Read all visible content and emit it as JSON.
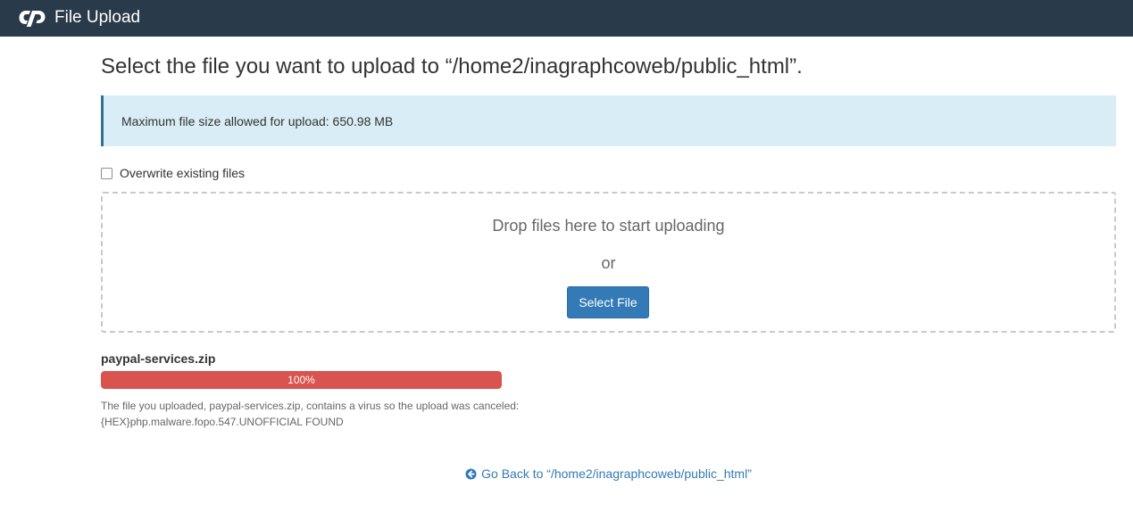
{
  "header": {
    "app_title": "File Upload",
    "logo_icon": "cpanel-logo-icon",
    "background": "#293a4a"
  },
  "main": {
    "title": "Select the file you want to upload to “/home2/inagraphcoweb/public_html”.",
    "info_alert": "Maximum file size allowed for upload: 650.98 MB",
    "overwrite_label": "Overwrite existing files",
    "overwrite_checked": false,
    "dropzone": {
      "drop_text": "Drop files here to start uploading",
      "or_text": "or",
      "select_button_label": "Select File"
    },
    "upload": {
      "file_name": "paypal-services.zip",
      "progress_label": "100%",
      "progress_fraction": 1.0,
      "status_color": "#d9534f",
      "error_line1": "The file you uploaded, paypal-services.zip, contains a virus so the upload was canceled:",
      "error_line2": "{HEX}php.malware.fopo.547.UNOFFICIAL FOUND"
    },
    "go_back_label": "Go Back to “/home2/inagraphcoweb/public_html”",
    "go_back_icon": "arrow-circle-left-icon",
    "accent_color": "#337ab7"
  }
}
